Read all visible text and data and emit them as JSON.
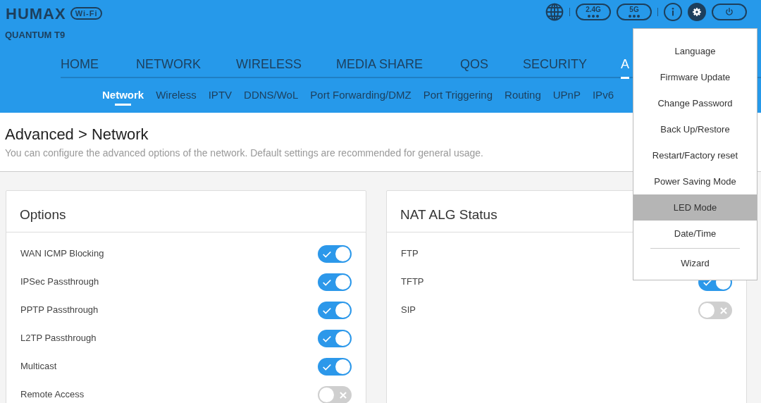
{
  "header": {
    "logo": "HUMAX",
    "logo_tag": "Wi-Fi",
    "model": "QUANTUM T9",
    "status_buttons": [
      {
        "kind": "globe"
      },
      {
        "kind": "band",
        "label": "2.4G"
      },
      {
        "kind": "band",
        "label": "5G"
      },
      {
        "kind": "info"
      },
      {
        "kind": "settings",
        "selected": true
      },
      {
        "kind": "power"
      }
    ]
  },
  "main_nav": [
    {
      "label": "HOME",
      "selected": false
    },
    {
      "label": "NETWORK",
      "selected": false
    },
    {
      "label": "WIRELESS",
      "selected": false
    },
    {
      "label": "MEDIA SHARE",
      "selected": false
    },
    {
      "label": "QOS",
      "selected": false
    },
    {
      "label": "SECURITY",
      "selected": false
    },
    {
      "label": "A",
      "selected": true
    }
  ],
  "sub_nav": [
    {
      "label": "Network",
      "selected": true
    },
    {
      "label": "Wireless",
      "selected": false
    },
    {
      "label": "IPTV",
      "selected": false
    },
    {
      "label": "DDNS/WoL",
      "selected": false
    },
    {
      "label": "Port Forwarding/DMZ",
      "selected": false
    },
    {
      "label": "Port Triggering",
      "selected": false
    },
    {
      "label": "Routing",
      "selected": false
    },
    {
      "label": "UPnP",
      "selected": false
    },
    {
      "label": "IPv6",
      "selected": false
    }
  ],
  "page": {
    "title": "Advanced > Network",
    "subtitle": "You can configure the advanced options of the network. Default settings are recommended for general usage."
  },
  "panels": [
    {
      "title": "Options",
      "rows": [
        {
          "label": "WAN ICMP Blocking",
          "on": true
        },
        {
          "label": "IPSec Passthrough",
          "on": true
        },
        {
          "label": "PPTP Passthrough",
          "on": true
        },
        {
          "label": "L2TP Passthrough",
          "on": true
        },
        {
          "label": "Multicast",
          "on": true
        },
        {
          "label": "Remote Access",
          "on": false
        }
      ]
    },
    {
      "title": "NAT ALG Status",
      "rows": [
        {
          "label": "FTP"
        },
        {
          "label": "TFTP",
          "on": true
        },
        {
          "label": "SIP",
          "on": false
        }
      ]
    }
  ],
  "settings_menu": {
    "items": [
      {
        "label": "Language",
        "selected": false
      },
      {
        "label": "Firmware Update",
        "selected": false
      },
      {
        "label": "Change Password",
        "selected": false
      },
      {
        "label": "Back Up/Restore",
        "selected": false
      },
      {
        "label": "Restart/Factory reset",
        "selected": false
      },
      {
        "label": "Power Saving Mode",
        "selected": false
      },
      {
        "label": "LED Mode",
        "selected": true
      },
      {
        "label": "Date/Time",
        "selected": false
      }
    ],
    "footer_items": [
      {
        "label": "Wizard",
        "selected": false
      }
    ]
  }
}
